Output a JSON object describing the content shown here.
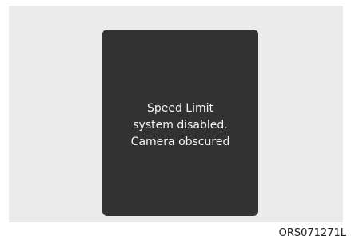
{
  "display": {
    "message_lines": [
      "Speed Limit",
      "system disabled.",
      "Camera obscured"
    ]
  },
  "figure_code": "ORS071271L",
  "colors": {
    "panel_background": "#ebebeb",
    "display_background": "#323232",
    "message_text": "#f4f4f4"
  }
}
